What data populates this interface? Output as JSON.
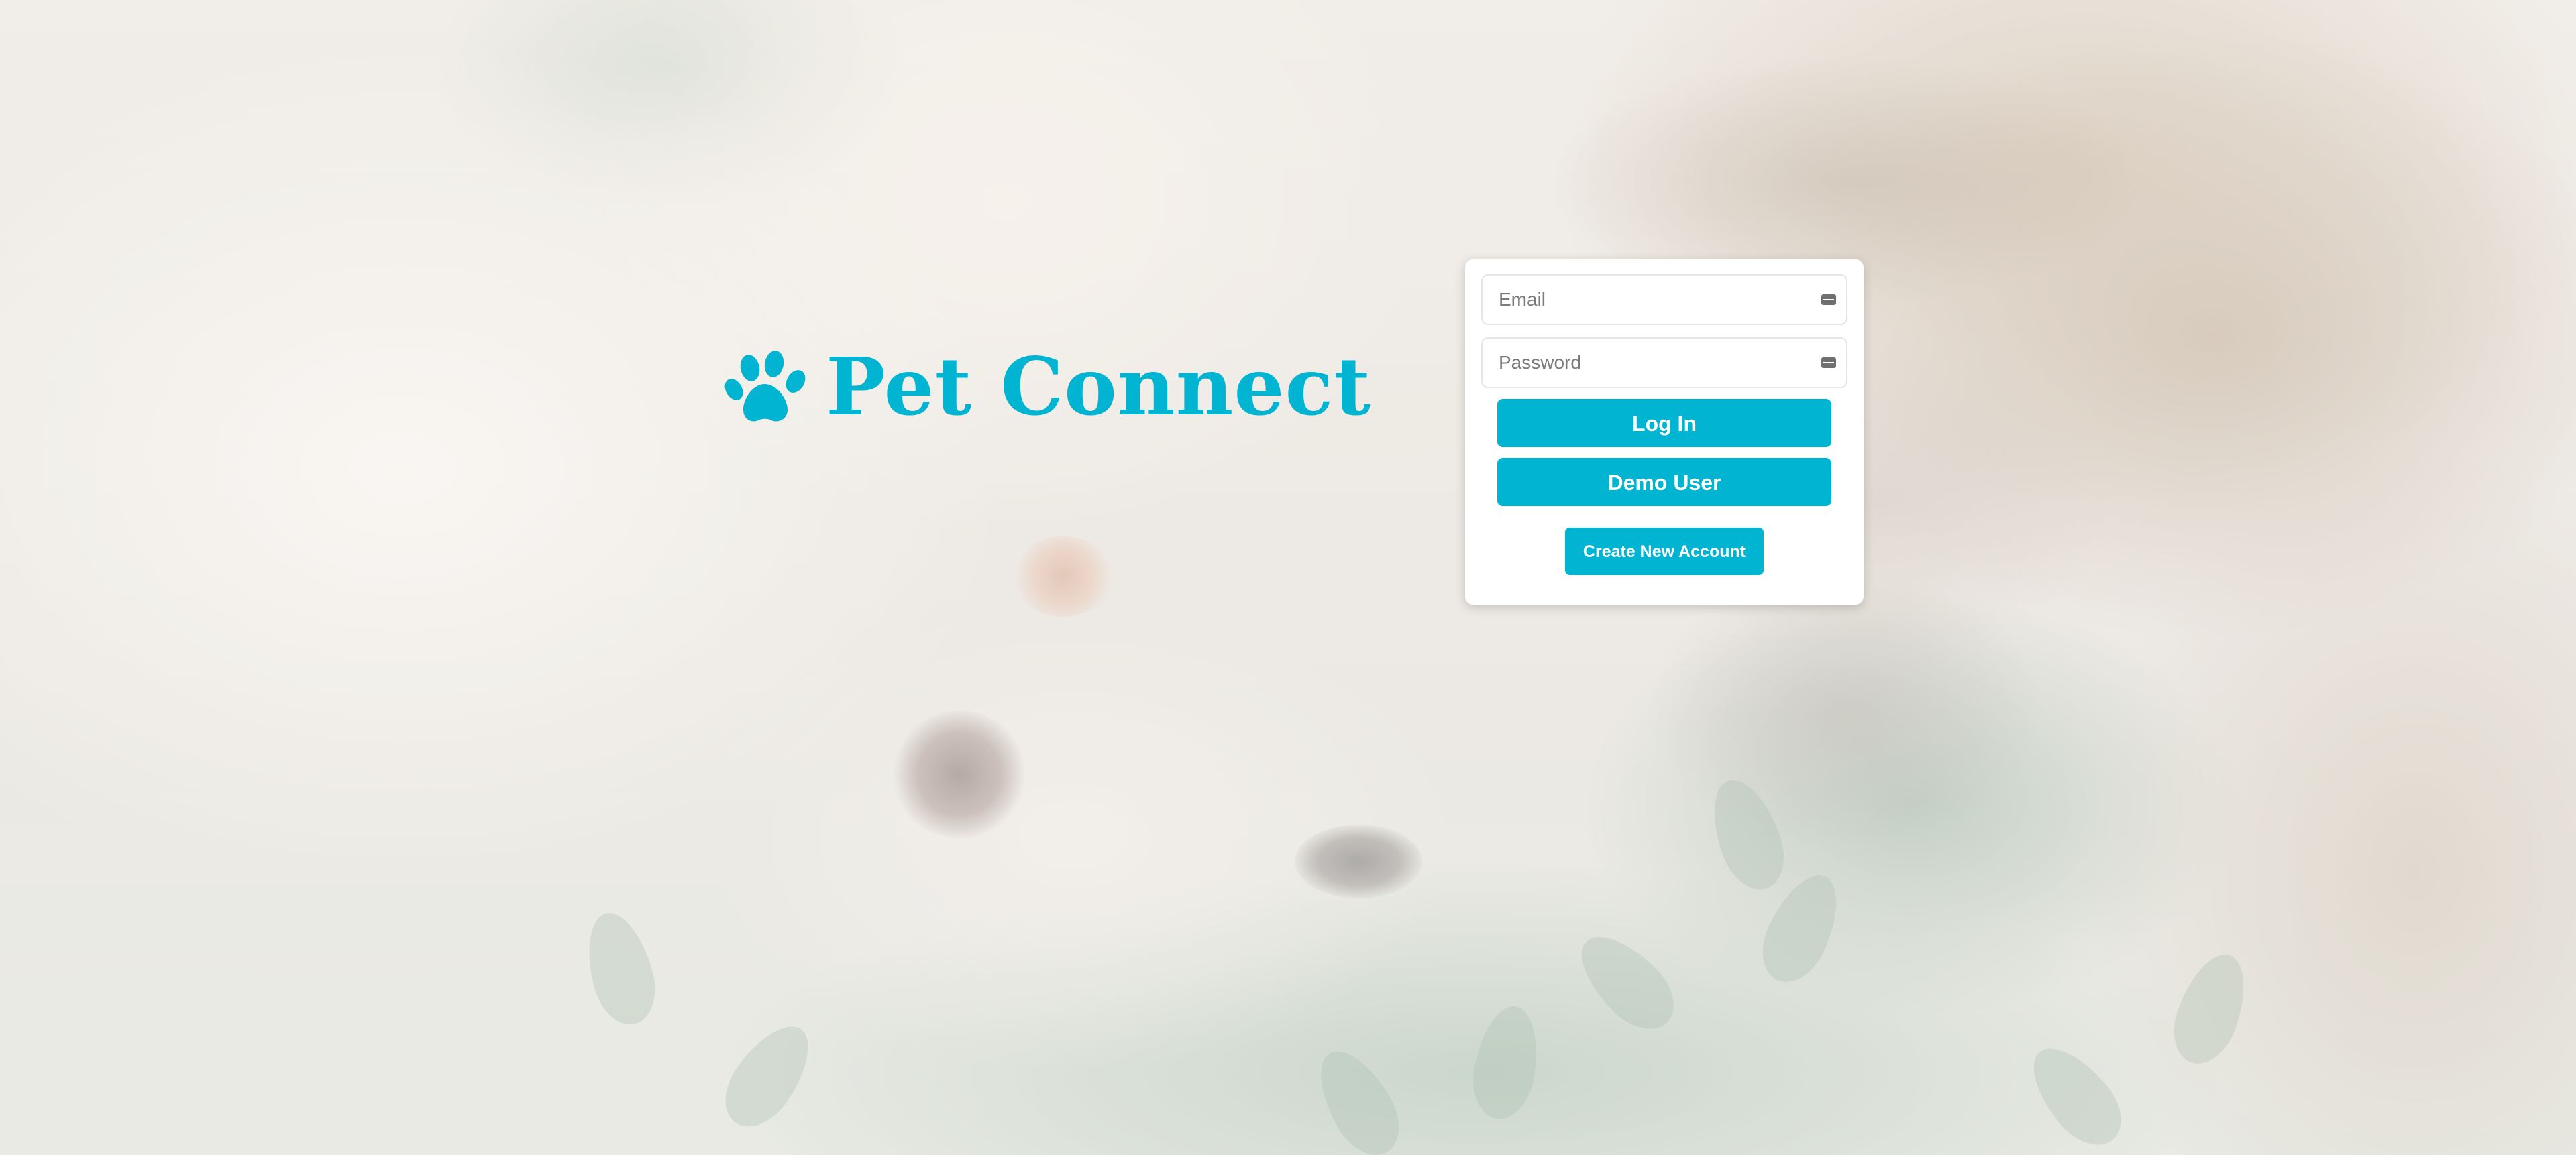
{
  "brand": {
    "name": "Pet Connect",
    "icon": "paw-icon",
    "color": "#00b4d2"
  },
  "login": {
    "email": {
      "placeholder": "Email",
      "value": ""
    },
    "password": {
      "placeholder": "Password",
      "value": ""
    },
    "field_icon": "key-icon",
    "login_label": "Log In",
    "demo_label": "Demo User",
    "create_label": "Create New Account"
  },
  "background": {
    "image": "dog-and-cat-photo"
  }
}
